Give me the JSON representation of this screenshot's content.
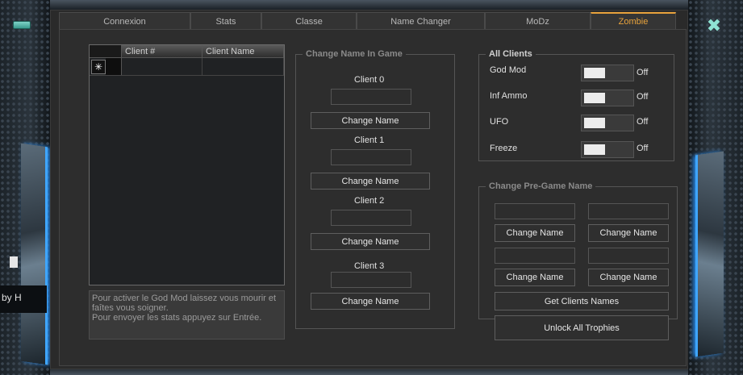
{
  "tabs": [
    {
      "label": "Connexion"
    },
    {
      "label": "Stats"
    },
    {
      "label": "Classe"
    },
    {
      "label": "Name Changer"
    },
    {
      "label": "MoDz"
    },
    {
      "label": "Zombie"
    }
  ],
  "active_tab": "Zombie",
  "accent_color": "#e8a23c",
  "side_label": "by H",
  "client_table": {
    "columns": [
      "Client #",
      "Client Name"
    ],
    "new_row_marker": "✳"
  },
  "info_text": {
    "line1": "Pour activer le God Mod laissez vous mourir et",
    "line2": "faîtes vous soigner.",
    "line3": "Pour envoyer les stats appuyez sur Entrée."
  },
  "change_name_in_game": {
    "title": "Change Name In Game",
    "clients": [
      {
        "label": "Client 0",
        "value": "",
        "button": "Change Name"
      },
      {
        "label": "Client 1",
        "value": "",
        "button": "Change Name"
      },
      {
        "label": "Client 2",
        "value": "",
        "button": "Change Name"
      },
      {
        "label": "Client 3",
        "value": "",
        "button": "Change Name"
      }
    ]
  },
  "all_clients": {
    "title": "All Clients",
    "toggles": [
      {
        "label": "God Mod",
        "state": "Off"
      },
      {
        "label": "Inf Ammo",
        "state": "Off"
      },
      {
        "label": "UFO",
        "state": "Off"
      },
      {
        "label": "Freeze",
        "state": "Off"
      }
    ]
  },
  "pre_game": {
    "title": "Change Pre-Game Name",
    "buttons": [
      "Change Name",
      "Change Name",
      "Change Name",
      "Change Name"
    ],
    "get_names": "Get Clients Names"
  },
  "unlock_trophies": "Unlock All Trophies"
}
